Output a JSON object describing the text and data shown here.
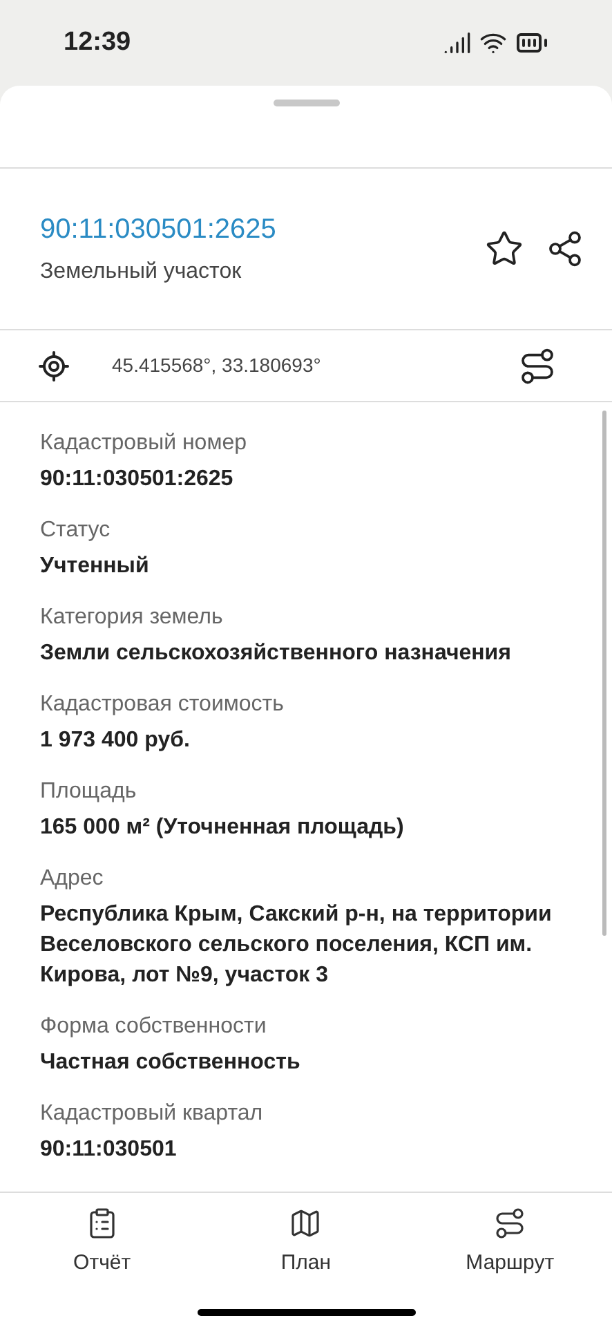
{
  "status_bar": {
    "time": "12:39"
  },
  "header": {
    "number": "90:11:030501:2625",
    "subtitle": "Земельный участок",
    "favorite": false
  },
  "coordinates": "45.415568°, 33.180693°",
  "fields": [
    {
      "label": "Кадастровый номер",
      "value": "90:11:030501:2625"
    },
    {
      "label": "Статус",
      "value": "Учтенный"
    },
    {
      "label": "Категория земель",
      "value": "Земли сельскохозяйственного назначения"
    },
    {
      "label": "Кадастровая стоимость",
      "value": "1 973 400 руб."
    },
    {
      "label": "Площадь",
      "value": "165 000 м² (Уточненная площадь)"
    },
    {
      "label": "Адрес",
      "value": "Республика Крым, Сакский р-н, на территории Веселовского сельского поселения, КСП им. Кирова, лот №9, участок 3"
    },
    {
      "label": "Форма собственности",
      "value": "Частная собственность"
    },
    {
      "label": "Кадастровый квартал",
      "value": "90:11:030501"
    }
  ],
  "tabs": [
    {
      "kind": "report",
      "label": "Отчёт"
    },
    {
      "kind": "plan",
      "label": "План"
    },
    {
      "kind": "route",
      "label": "Маршрут"
    }
  ]
}
